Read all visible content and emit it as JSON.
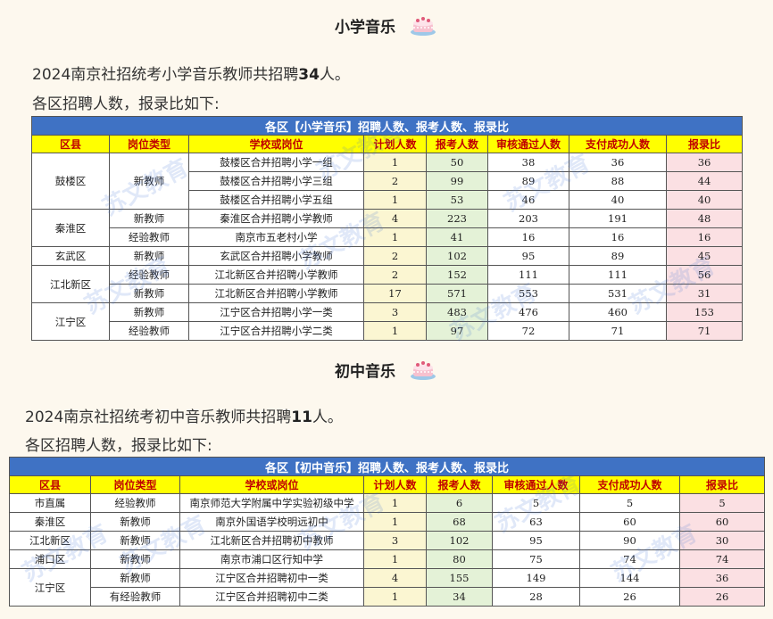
{
  "section1": {
    "heading": "小学音乐",
    "intro_prefix": "2024南京社招统考小学音乐教师共招聘",
    "intro_count": "34",
    "intro_suffix": "人。",
    "sub": "各区招聘人数，报录比如下:",
    "table": {
      "caption": "各区【小学音乐】招聘人数、报考人数、报录比",
      "headers": [
        "区县",
        "岗位类型",
        "学校或岗位",
        "计划人数",
        "报考人数",
        "审核通过人数",
        "支付成功人数",
        "报录比"
      ],
      "rows": [
        {
          "district": "鼓楼区",
          "type": "新教师",
          "school": "鼓楼区合并招聘小学一组",
          "plan": "1",
          "apply": "50",
          "passed": "38",
          "paid": "36",
          "ratio": "36"
        },
        {
          "district": "",
          "type": "",
          "school": "鼓楼区合并招聘小学三组",
          "plan": "2",
          "apply": "99",
          "passed": "89",
          "paid": "88",
          "ratio": "44"
        },
        {
          "district": "",
          "type": "",
          "school": "鼓楼区合并招聘小学五组",
          "plan": "1",
          "apply": "53",
          "passed": "46",
          "paid": "40",
          "ratio": "40"
        },
        {
          "district": "秦淮区",
          "type": "新教师",
          "school": "秦淮区合并招聘小学教师",
          "plan": "4",
          "apply": "223",
          "passed": "203",
          "paid": "191",
          "ratio": "48"
        },
        {
          "district": "",
          "type": "经验教师",
          "school": "南京市五老村小学",
          "plan": "1",
          "apply": "41",
          "passed": "16",
          "paid": "16",
          "ratio": "16"
        },
        {
          "district": "玄武区",
          "type": "新教师",
          "school": "玄武区合并招聘小学教师",
          "plan": "2",
          "apply": "102",
          "passed": "95",
          "paid": "89",
          "ratio": "45"
        },
        {
          "district": "江北新区",
          "type": "经验教师",
          "school": "江北新区合并招聘小学教师",
          "plan": "2",
          "apply": "152",
          "passed": "111",
          "paid": "111",
          "ratio": "56"
        },
        {
          "district": "",
          "type": "新教师",
          "school": "江北新区合并招聘小学教师",
          "plan": "17",
          "apply": "571",
          "passed": "553",
          "paid": "531",
          "ratio": "31"
        },
        {
          "district": "江宁区",
          "type": "新教师",
          "school": "江宁区合并招聘小学一类",
          "plan": "3",
          "apply": "483",
          "passed": "476",
          "paid": "460",
          "ratio": "153"
        },
        {
          "district": "",
          "type": "经验教师",
          "school": "江宁区合并招聘小学二类",
          "plan": "1",
          "apply": "97",
          "passed": "72",
          "paid": "71",
          "ratio": "71"
        }
      ]
    }
  },
  "section2": {
    "heading": "初中音乐",
    "intro_prefix": "2024南京社招统考初中音乐教师共招聘",
    "intro_count": "11",
    "intro_suffix": "人。",
    "sub": "各区招聘人数，报录比如下:",
    "table": {
      "caption": "各区【初中音乐】招聘人数、报考人数、报录比",
      "headers": [
        "区县",
        "岗位类型",
        "学校或岗位",
        "计划人数",
        "报考人数",
        "审核通过人数",
        "支付成功人数",
        "报录比"
      ],
      "rows": [
        {
          "district": "市直属",
          "type": "经验教师",
          "school": "南京师范大学附属中学实验初级中学",
          "plan": "1",
          "apply": "6",
          "passed": "5",
          "paid": "5",
          "ratio": "5"
        },
        {
          "district": "秦淮区",
          "type": "新教师",
          "school": "南京外国语学校明远初中",
          "plan": "1",
          "apply": "68",
          "passed": "63",
          "paid": "60",
          "ratio": "60"
        },
        {
          "district": "江北新区",
          "type": "新教师",
          "school": "江北新区合并招聘初中教师",
          "plan": "3",
          "apply": "102",
          "passed": "95",
          "paid": "90",
          "ratio": "30"
        },
        {
          "district": "浦口区",
          "type": "新教师",
          "school": "南京市浦口区行知中学",
          "plan": "1",
          "apply": "80",
          "passed": "75",
          "paid": "74",
          "ratio": "74"
        },
        {
          "district": "江宁区",
          "type": "新教师",
          "school": "江宁区合并招聘初中一类",
          "plan": "4",
          "apply": "155",
          "passed": "149",
          "paid": "144",
          "ratio": "36"
        },
        {
          "district": "",
          "type": "有经验教师",
          "school": "江宁区合并招聘初中二类",
          "plan": "1",
          "apply": "34",
          "passed": "28",
          "paid": "26",
          "ratio": "26"
        }
      ]
    }
  },
  "watermark": "苏文教育",
  "icons": {
    "heading_deco": "cake-icon"
  },
  "colors": {
    "caption_bg": "#3f72c4",
    "header_bg": "#ffff00",
    "header_text": "#c00000",
    "plan_bg": "#fbf6d2",
    "apply_bg": "#e4f2d7",
    "ratio_bg": "#fbe0e3",
    "page_bg": "#fdf8ee"
  }
}
